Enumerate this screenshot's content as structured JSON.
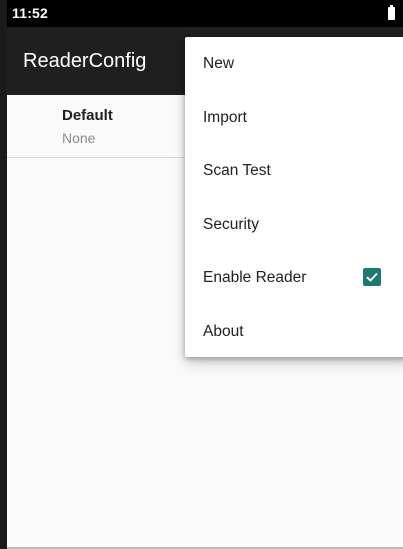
{
  "status_bar": {
    "time": "11:52",
    "battery_icon": "battery-icon"
  },
  "app_bar": {
    "title": "ReaderConfig"
  },
  "list": {
    "items": [
      {
        "title": "Default",
        "subtitle": "None"
      }
    ]
  },
  "menu": {
    "items": [
      {
        "label": "New"
      },
      {
        "label": "Import"
      },
      {
        "label": "Scan Test"
      },
      {
        "label": "Security"
      },
      {
        "label": "Enable Reader",
        "checked": true
      },
      {
        "label": "About"
      }
    ]
  },
  "colors": {
    "app_bar": "#1f1f1f",
    "status_bar": "#000000",
    "checkbox_accent": "#1d7a70"
  }
}
